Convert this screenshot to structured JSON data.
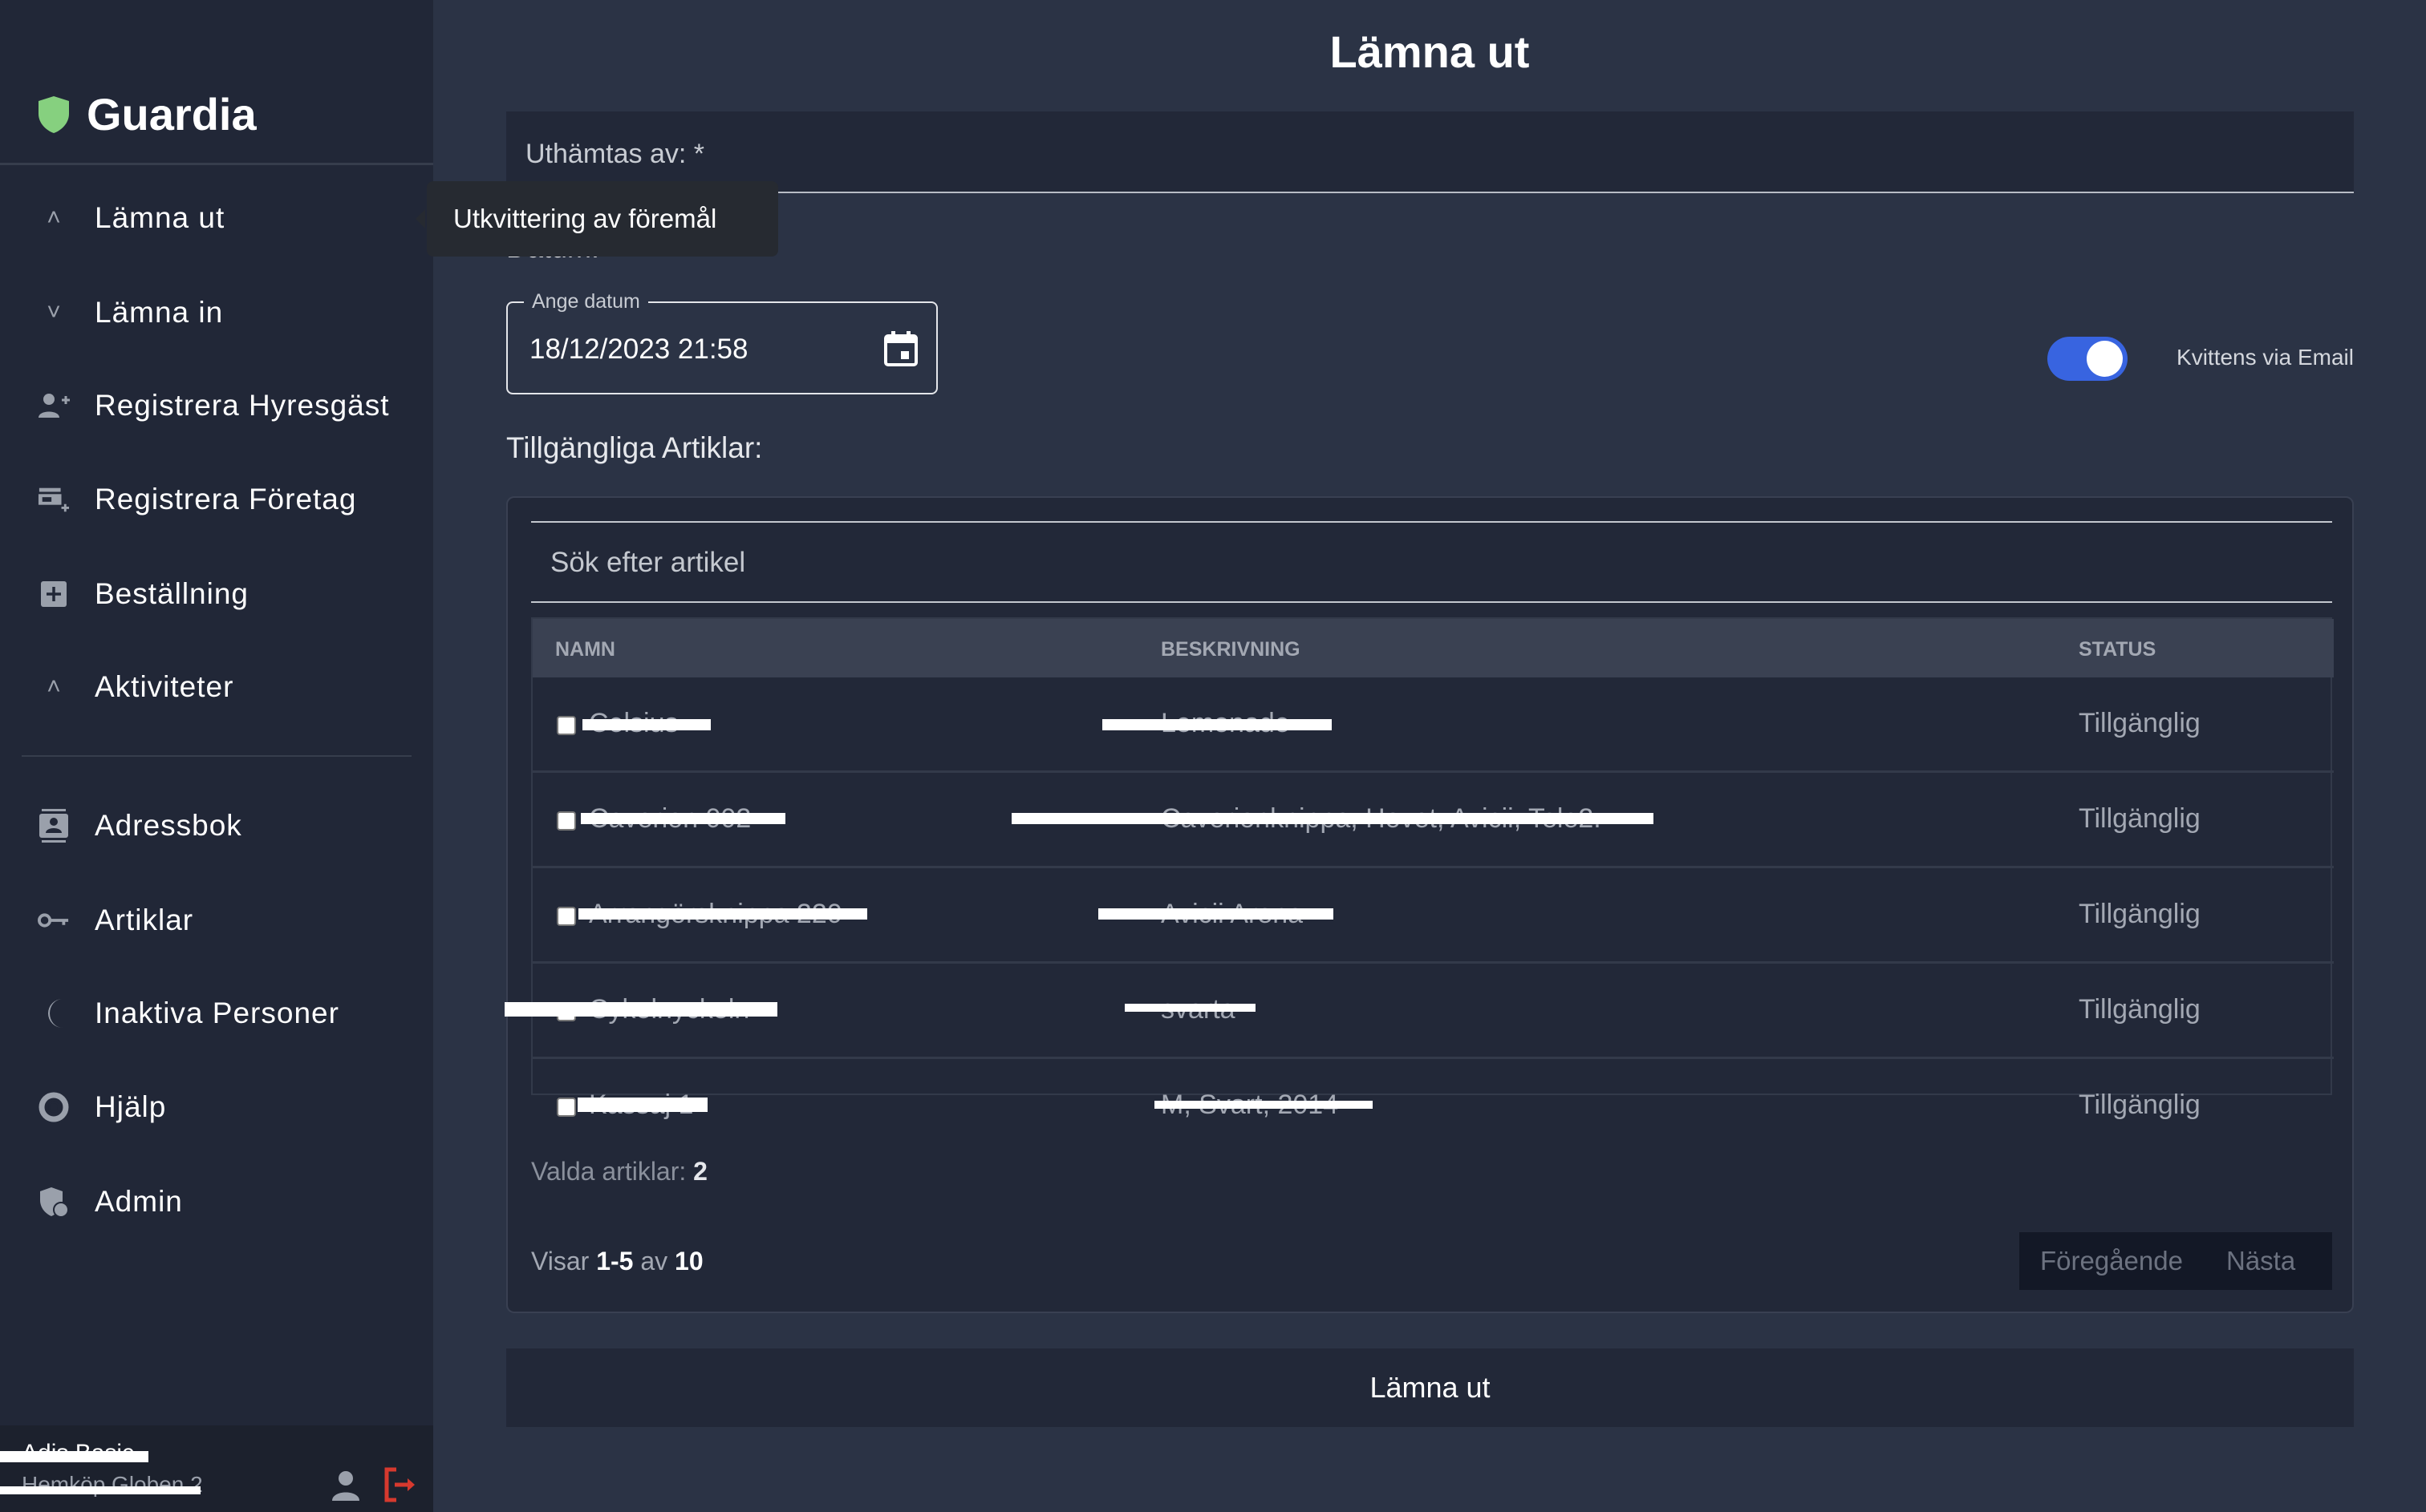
{
  "app": {
    "name": "Guardia",
    "brand_color": "#86d07f"
  },
  "sidebar": {
    "items": [
      {
        "label": "Lämna ut",
        "icon": "chevron-up-icon"
      },
      {
        "label": "Lämna in",
        "icon": "chevron-down-icon"
      },
      {
        "label": "Registrera Hyresgäst",
        "icon": "person-add-icon"
      },
      {
        "label": "Registrera Företag",
        "icon": "store-add-icon"
      },
      {
        "label": "Beställning",
        "icon": "plus-box-icon"
      },
      {
        "label": "Aktiviteter",
        "icon": "chevron-up-icon"
      },
      {
        "label": "Adressbok",
        "icon": "contact-book-icon"
      },
      {
        "label": "Artiklar",
        "icon": "key-icon"
      },
      {
        "label": "Inaktiva Personer",
        "icon": "moon-icon"
      },
      {
        "label": "Hjälp",
        "icon": "lifebuoy-icon"
      },
      {
        "label": "Admin",
        "icon": "admin-shield-icon"
      }
    ],
    "user": {
      "name": "Adis Basic",
      "location": "Hemköp Globen 2"
    }
  },
  "tooltip": "Utkvittering av föremål",
  "main": {
    "title": "Lämna ut",
    "picked_up_by_label": "Uthämtas av: *",
    "date_heading": "Datum:",
    "date_label": "Ange datum",
    "date_value": "18/12/2023 21:58",
    "email_toggle": {
      "label": "Kvittens via Email",
      "on": true,
      "color": "#3864e0"
    },
    "articles_heading": "Tillgängliga Artiklar:",
    "search_placeholder": "Sök efter artikel",
    "columns": [
      "NAMN",
      "BESKRIVNING",
      "STATUS"
    ],
    "rows": [
      {
        "name": "Celsius",
        "description": "Lemonade",
        "status": "Tillgänglig"
      },
      {
        "name": "Caverion 002",
        "description": "Caverionknippa, Hovet, Avicii, Tele2.",
        "status": "Tillgänglig"
      },
      {
        "name": "Arrangörsknippa 220",
        "description": "Avicii Arena",
        "status": "Tillgänglig"
      },
      {
        "name": "Cykelnyckeln",
        "description": "svarta",
        "status": "Tillgänglig"
      },
      {
        "name": "Kassaj 1",
        "description": "M, Svart, 2014",
        "status": "Tillgänglig"
      }
    ],
    "selected_label": "Valda artiklar:",
    "selected_count": "2",
    "showing_prefix": "Visar",
    "showing_range": "1-5",
    "showing_of": "av",
    "showing_total": "10",
    "prev_label": "Föregående",
    "next_label": "Nästa",
    "submit_label": "Lämna ut"
  }
}
